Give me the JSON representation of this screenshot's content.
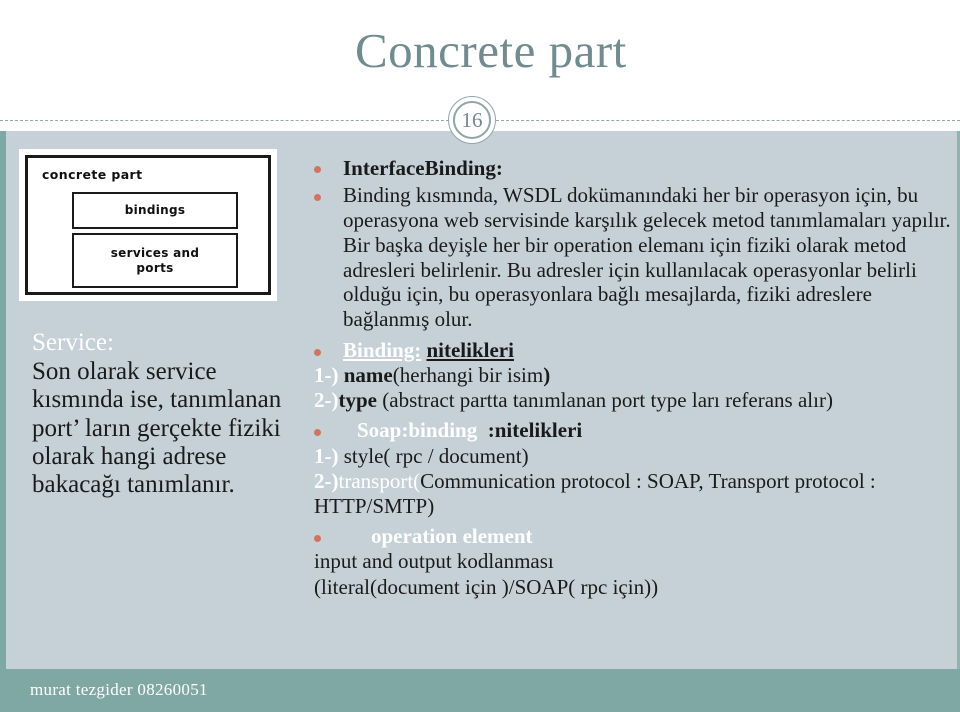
{
  "slide": {
    "title": "Concrete part",
    "page_number": "16",
    "accent_teal": "#7fa8a4",
    "title_color": "#718c8e",
    "panel_background": "#c6d1d7",
    "bullet_color": "#d4735b"
  },
  "diagram": {
    "outer_label": "concrete part",
    "boxes": [
      {
        "label": "bindings"
      },
      {
        "label": "services and\nports"
      }
    ]
  },
  "service": {
    "heading": "Service:",
    "body": "Son olarak service kısmında ise, tanımlanan port’ ların gerçekte fiziki olarak hangi adrese bakacağı tanımlanır."
  },
  "content": {
    "interface_binding_heading": "InterfaceBinding:",
    "interface_binding_paragraph": "Binding kısmında, WSDL dokümanındaki her bir operasyon için, bu operasyona web servisinde karşılık gelecek metod tanımlamaları yapılır. Bir başka deyişle her bir operation elemanı için fiziki olarak metod adresleri belirlenir. Bu adresler için kullanılacak operasyonlar belirli olduğu için, bu operasyonlara bağlı mesajlarda, fiziki adreslere bağlanmış olur.",
    "binding_attrs_label_white": "Binding:",
    "binding_attrs_label_black": "nitelikleri",
    "binding_attrs": [
      {
        "marker": "1-)",
        "name": "name",
        "rest": "(herhangi  bir isim",
        "tail": ")"
      },
      {
        "marker": "2-)",
        "name": "type",
        "rest": " (abstract  partta  tanımlanan  port  type ları referans alır)",
        "tail": ""
      }
    ],
    "soap_binding_label_white": "Soap:binding",
    "soap_binding_label_black": ":nitelikleri",
    "soap_binding_attrs": [
      {
        "marker": "1-)",
        "name": "",
        "rest": " style(  rpc / document)"
      },
      {
        "marker": "2-)",
        "name_white": "transport(",
        "rest": "Communication protocol : SOAP, Transport protocol : HTTP/SMTP)"
      }
    ],
    "operation_element_label": "operation element",
    "operation_lines": [
      "input and output  kodlanması",
      "(literal(document  için )/SOAP( rpc için))"
    ]
  },
  "footer": {
    "text": "murat tezgider 08260051"
  }
}
